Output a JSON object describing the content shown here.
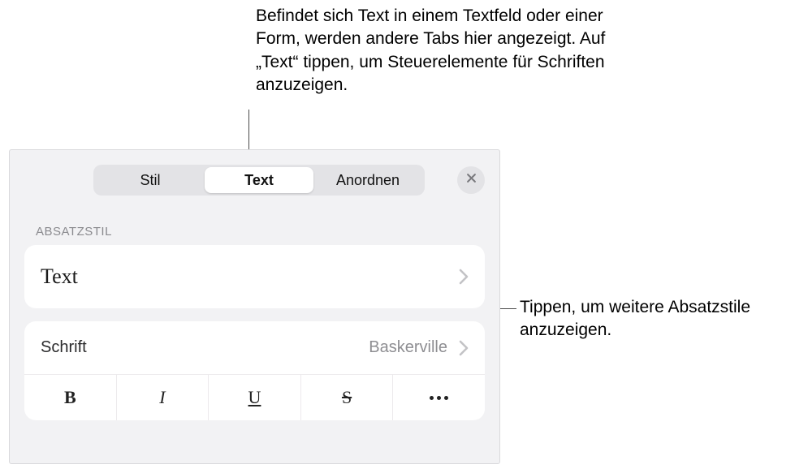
{
  "annotations": {
    "top": "Befindet sich Text in einem Textfeld oder einer Form, werden andere Tabs hier angezeigt. Auf „Text“ tippen, um Steuerelemente für Schriften anzuzeigen.",
    "right": "Tippen, um weitere Absatzstile anzuzeigen."
  },
  "tabs": {
    "style": "Stil",
    "text": "Text",
    "arrange": "Anordnen"
  },
  "section": {
    "paragraph_style_label": "ABSATZSTIL"
  },
  "paragraph_style": {
    "current": "Text"
  },
  "font": {
    "label": "Schrift",
    "value": "Baskerville"
  },
  "format_buttons": {
    "bold": "B",
    "italic": "I",
    "underline": "U",
    "strike": "S"
  }
}
